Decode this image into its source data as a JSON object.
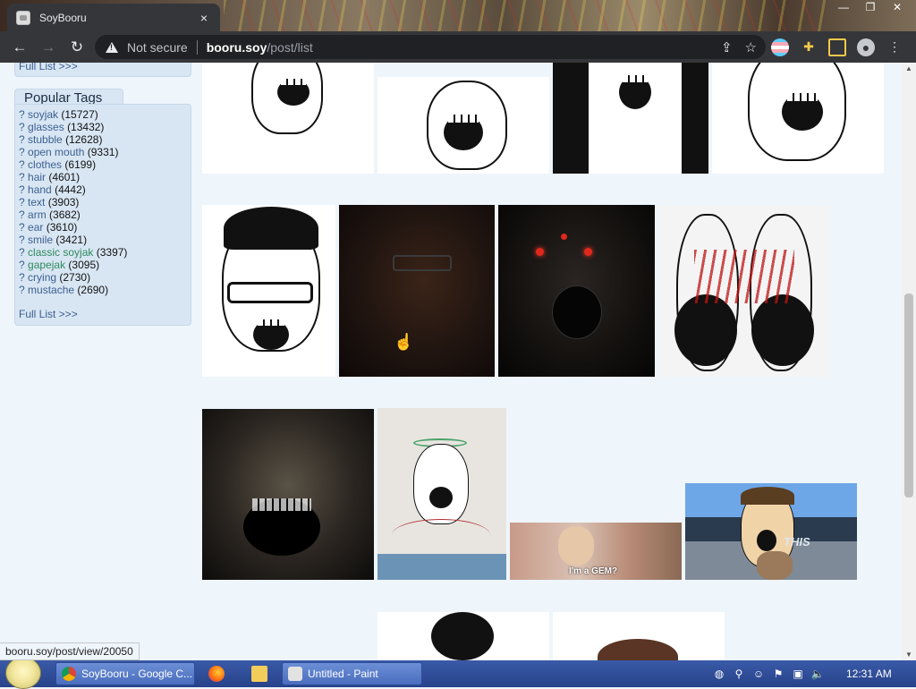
{
  "browser": {
    "tab_title": "SoyBooru",
    "close_glyph": "×",
    "window_controls": [
      "—",
      "❐",
      "✕"
    ],
    "security_label": "Not secure",
    "url_host": "booru.soy",
    "url_path": "/post/list",
    "back_glyph": "←",
    "forward_glyph": "→",
    "reload_glyph": "↻"
  },
  "sidebar": {
    "top_full_list": "Full List >>>",
    "popular_tags_title": "Popular Tags",
    "tags": [
      {
        "q": "?",
        "name": "soyjak",
        "count": "(15727)",
        "color": "#3b5f91"
      },
      {
        "q": "?",
        "name": "glasses",
        "count": "(13432)",
        "color": "#3b5f91"
      },
      {
        "q": "?",
        "name": "stubble",
        "count": "(12628)",
        "color": "#3b5f91"
      },
      {
        "q": "?",
        "name": "open mouth",
        "count": "(9331)",
        "color": "#3b5f91"
      },
      {
        "q": "?",
        "name": "clothes",
        "count": "(6199)",
        "color": "#3b5f91"
      },
      {
        "q": "?",
        "name": "hair",
        "count": "(4601)",
        "color": "#3b5f91"
      },
      {
        "q": "?",
        "name": "hand",
        "count": "(4442)",
        "color": "#3b5f91"
      },
      {
        "q": "?",
        "name": "text",
        "count": "(3903)",
        "color": "#3b5f91"
      },
      {
        "q": "?",
        "name": "arm",
        "count": "(3682)",
        "color": "#3b5f91"
      },
      {
        "q": "?",
        "name": "ear",
        "count": "(3610)",
        "color": "#3b5f91"
      },
      {
        "q": "?",
        "name": "smile",
        "count": "(3421)",
        "color": "#3b5f91"
      },
      {
        "q": "?",
        "name": "classic soyjak",
        "count": "(3397)",
        "color": "#2f8a5e"
      },
      {
        "q": "?",
        "name": "gapejak",
        "count": "(3095)",
        "color": "#2f8a5e"
      },
      {
        "q": "?",
        "name": "crying",
        "count": "(2730)",
        "color": "#3b5f91"
      },
      {
        "q": "?",
        "name": "mustache",
        "count": "(2690)",
        "color": "#3b5f91"
      }
    ],
    "full_list": "Full List >>>"
  },
  "thumbnails": {
    "gem_caption": "I'm a GEM?",
    "this_caption": "THIS"
  },
  "status": {
    "hover_url": "booru.soy/post/view/20050"
  },
  "taskbar": {
    "chrome_item": "SoyBooru - Google C...",
    "paint_item": "Untitled - Paint",
    "clock": "12:31 AM"
  }
}
